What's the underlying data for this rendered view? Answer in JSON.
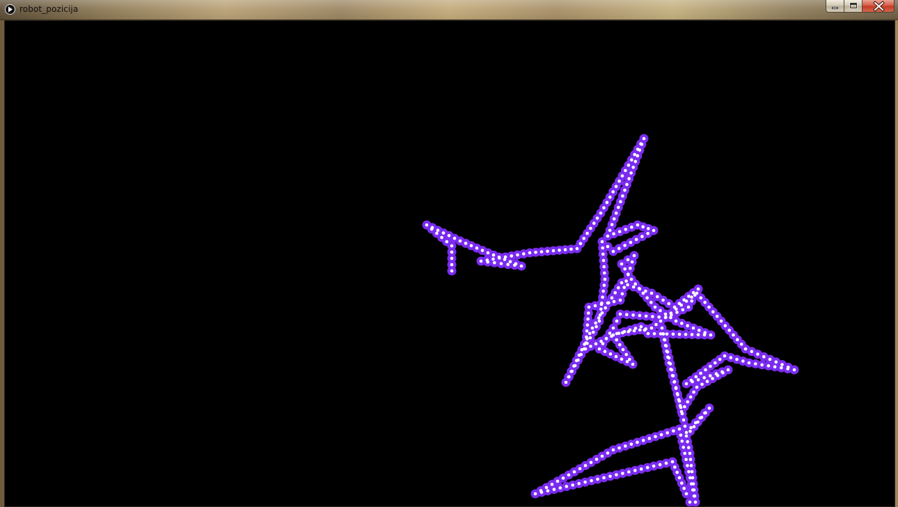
{
  "window": {
    "title": "robot_pozicija",
    "buttons": {
      "minimize": "minimize",
      "maximize": "maximize",
      "close": "close"
    }
  },
  "icons": {
    "app": "play-icon",
    "minimize": "minimize-icon",
    "maximize": "maximize-icon",
    "close": "close-icon"
  },
  "canvas": {
    "background": "#000000",
    "dot_color": "#7b2cf0",
    "dot_center_color": "#ffffff"
  }
}
